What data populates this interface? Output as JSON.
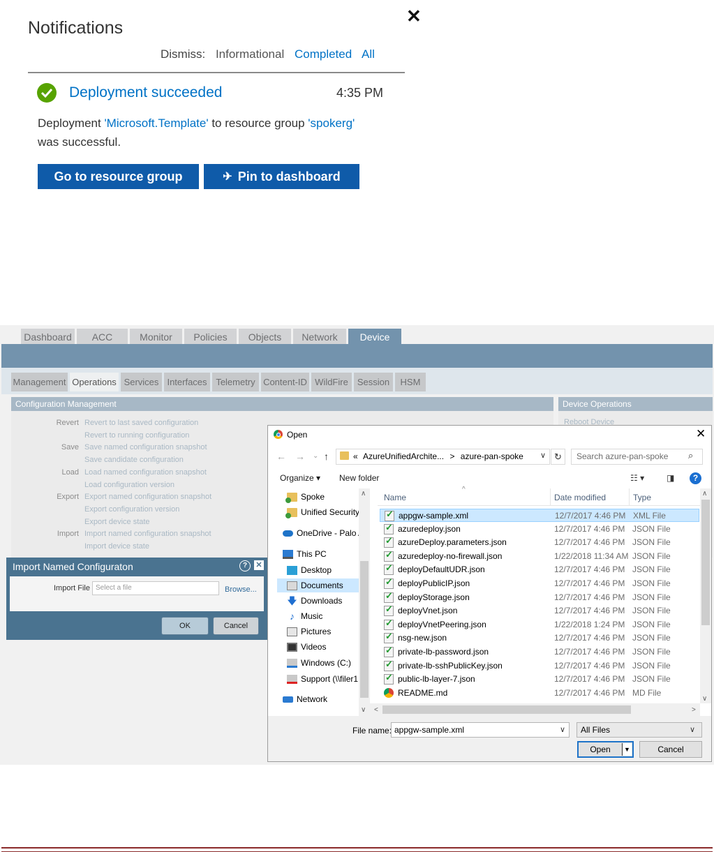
{
  "notification": {
    "title": "Notifications",
    "close_icon": "close-icon",
    "dismiss_label": "Dismiss:",
    "dismiss_informational": "Informational",
    "dismiss_completed": "Completed",
    "dismiss_all": "All",
    "status_title": "Deployment succeeded",
    "time": "4:35 PM",
    "msg_prefix": "Deployment ",
    "msg_template": "'Microsoft.Template'",
    "msg_mid": " to resource group ",
    "msg_rg": "'spokerg'",
    "msg_end": "was successful.",
    "btn_resource_group": "Go to resource group",
    "btn_pin": "Pin to dashboard",
    "accent": "#0072c6",
    "success_color": "#57a300"
  },
  "firewall": {
    "tabs": [
      "Dashboard",
      "ACC",
      "Monitor",
      "Policies",
      "Objects",
      "Network",
      "Device"
    ],
    "active_tab": "Device",
    "subtabs": [
      "Management",
      "Operations",
      "Services",
      "Interfaces",
      "Telemetry",
      "Content-ID",
      "WildFire",
      "Session",
      "HSM"
    ],
    "active_subtab": "Operations",
    "config_panel_title": "Configuration Management",
    "device_ops_title": "Device Operations",
    "device_ops_link": "Reboot Device",
    "config_rows": [
      {
        "label": "Revert",
        "link": "Revert to last saved configuration"
      },
      {
        "label": "",
        "link": "Revert to running configuration"
      },
      {
        "label": "Save",
        "link": "Save named configuration snapshot"
      },
      {
        "label": "",
        "link": "Save candidate configuration"
      },
      {
        "label": "Load",
        "link": "Load named configuration snapshot"
      },
      {
        "label": "",
        "link": "Load configuration version"
      },
      {
        "label": "Export",
        "link": "Export named configuration snapshot"
      },
      {
        "label": "",
        "link": "Export configuration version"
      },
      {
        "label": "",
        "link": "Export device state"
      },
      {
        "label": "Import",
        "link": "Import named configuration snapshot"
      },
      {
        "label": "",
        "link": "Import device state"
      }
    ],
    "import_dialog": {
      "title": "Import Named Configuraton",
      "file_label": "Import File",
      "placeholder": "Select a file",
      "browse": "Browse...",
      "ok": "OK",
      "cancel": "Cancel"
    }
  },
  "open_dialog": {
    "title": "Open",
    "address_prefix": "«",
    "address_crumbs": [
      "AzureUnifiedArchite...",
      "azure-pan-spoke"
    ],
    "address_sep": ">",
    "search_placeholder": "Search azure-pan-spoke",
    "organize": "Organize ▾",
    "new_folder": "New folder",
    "tree": [
      {
        "label": "Spoke",
        "icon": "folder-sync-icon"
      },
      {
        "label": "Unified Security",
        "icon": "folder-sync-icon"
      },
      {
        "label": "OneDrive - Palo A",
        "icon": "onedrive-icon"
      },
      {
        "label": "This PC",
        "icon": "pc-icon"
      },
      {
        "label": "Desktop",
        "icon": "desktop-icon"
      },
      {
        "label": "Documents",
        "icon": "documents-icon",
        "selected": true
      },
      {
        "label": "Downloads",
        "icon": "downloads-icon"
      },
      {
        "label": "Music",
        "icon": "music-icon"
      },
      {
        "label": "Pictures",
        "icon": "pictures-icon"
      },
      {
        "label": "Videos",
        "icon": "videos-icon"
      },
      {
        "label": "Windows (C:)",
        "icon": "drive-icon"
      },
      {
        "label": "Support (\\\\filer1",
        "icon": "network-drive-icon"
      },
      {
        "label": "Network",
        "icon": "network-icon"
      }
    ],
    "columns": {
      "name": "Name",
      "date": "Date modified",
      "type": "Type"
    },
    "files": [
      {
        "name": "appgw-sample.xml",
        "date": "12/7/2017 4:46 PM",
        "type": "XML File",
        "selected": true
      },
      {
        "name": "azuredeploy.json",
        "date": "12/7/2017 4:46 PM",
        "type": "JSON File"
      },
      {
        "name": "azureDeploy.parameters.json",
        "date": "12/7/2017 4:46 PM",
        "type": "JSON File"
      },
      {
        "name": "azuredeploy-no-firewall.json",
        "date": "1/22/2018 11:34 AM",
        "type": "JSON File"
      },
      {
        "name": "deployDefaultUDR.json",
        "date": "12/7/2017 4:46 PM",
        "type": "JSON File"
      },
      {
        "name": "deployPublicIP.json",
        "date": "12/7/2017 4:46 PM",
        "type": "JSON File"
      },
      {
        "name": "deployStorage.json",
        "date": "12/7/2017 4:46 PM",
        "type": "JSON File"
      },
      {
        "name": "deployVnet.json",
        "date": "12/7/2017 4:46 PM",
        "type": "JSON File"
      },
      {
        "name": "deployVnetPeering.json",
        "date": "1/22/2018 1:24 PM",
        "type": "JSON File"
      },
      {
        "name": "nsg-new.json",
        "date": "12/7/2017 4:46 PM",
        "type": "JSON File"
      },
      {
        "name": "private-lb-password.json",
        "date": "12/7/2017 4:46 PM",
        "type": "JSON File"
      },
      {
        "name": "private-lb-sshPublicKey.json",
        "date": "12/7/2017 4:46 PM",
        "type": "JSON File"
      },
      {
        "name": "public-lb-layer-7.json",
        "date": "12/7/2017 4:46 PM",
        "type": "JSON File"
      },
      {
        "name": "README.md",
        "date": "12/7/2017 4:46 PM",
        "type": "MD File",
        "chrome": true
      }
    ],
    "file_name_label": "File name:",
    "file_name_value": "appgw-sample.xml",
    "file_type": "All Files",
    "btn_open": "Open",
    "btn_cancel": "Cancel"
  }
}
